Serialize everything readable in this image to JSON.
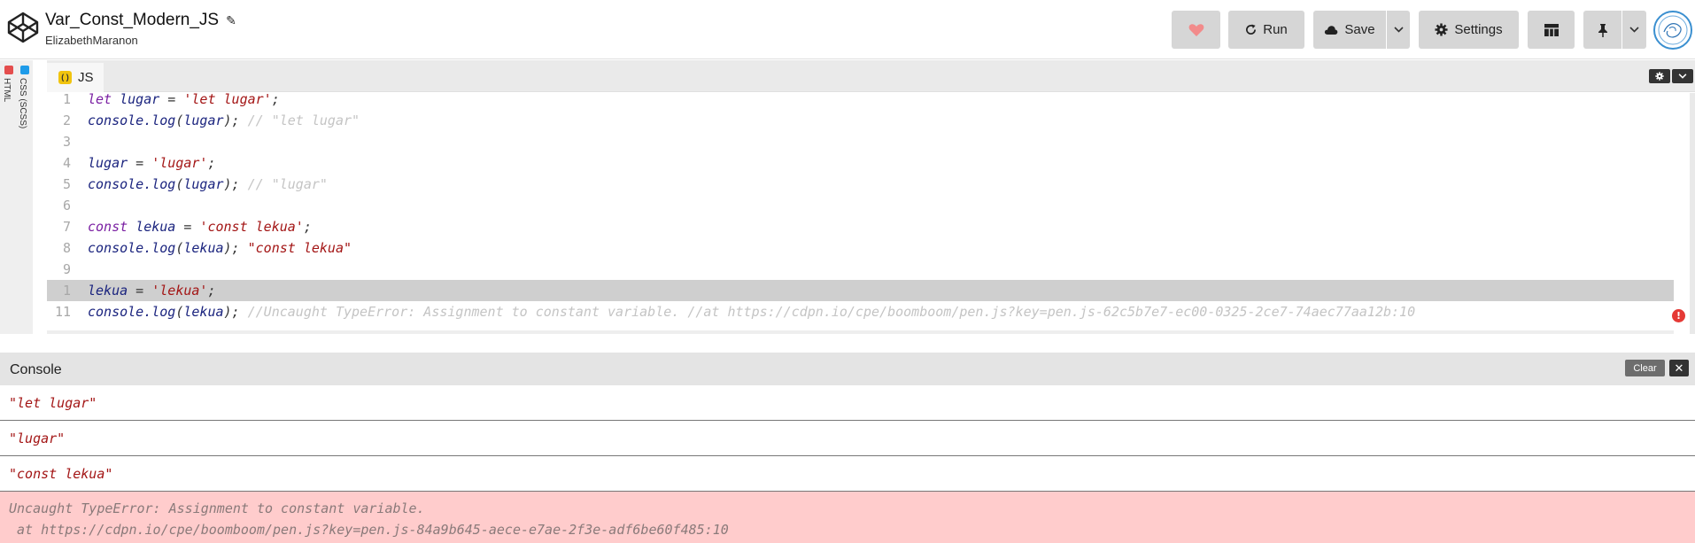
{
  "header": {
    "title": "Var_Const_Modern_JS",
    "user": "ElizabethMaranon",
    "run_label": "Run",
    "save_label": "Save",
    "settings_label": "Settings"
  },
  "side_tabs": {
    "html": "HTML",
    "css": "CSS (SCSS)"
  },
  "editor": {
    "tab_label": "JS",
    "tab_badge": "( )",
    "active_line": 10,
    "lines": [
      {
        "n": "1",
        "parts": [
          [
            "kw",
            "let "
          ],
          [
            "var",
            "lugar"
          ],
          [
            "pn",
            " = "
          ],
          [
            "str",
            "'let lugar'"
          ],
          [
            "pn",
            ";"
          ]
        ]
      },
      {
        "n": "2",
        "parts": [
          [
            "var",
            "console.log"
          ],
          [
            "pn",
            "("
          ],
          [
            "var",
            "lugar"
          ],
          [
            "pn",
            "); "
          ],
          [
            "cm",
            "// \"let lugar\""
          ]
        ]
      },
      {
        "n": "3",
        "parts": []
      },
      {
        "n": "4",
        "parts": [
          [
            "var",
            "lugar"
          ],
          [
            "pn",
            " = "
          ],
          [
            "str",
            "'lugar'"
          ],
          [
            "pn",
            ";"
          ]
        ]
      },
      {
        "n": "5",
        "parts": [
          [
            "var",
            "console.log"
          ],
          [
            "pn",
            "("
          ],
          [
            "var",
            "lugar"
          ],
          [
            "pn",
            "); "
          ],
          [
            "cm",
            "// \"lugar\""
          ]
        ]
      },
      {
        "n": "6",
        "parts": []
      },
      {
        "n": "7",
        "parts": [
          [
            "kw",
            "const "
          ],
          [
            "var",
            "lekua"
          ],
          [
            "pn",
            " = "
          ],
          [
            "str",
            "'const lekua'"
          ],
          [
            "pn",
            ";"
          ]
        ]
      },
      {
        "n": "8",
        "parts": [
          [
            "var",
            "console.log"
          ],
          [
            "pn",
            "("
          ],
          [
            "var",
            "lekua"
          ],
          [
            "pn",
            "); "
          ],
          [
            "str",
            "\"const lekua\""
          ]
        ]
      },
      {
        "n": "9",
        "parts": []
      },
      {
        "n": "1",
        "parts": [
          [
            "var",
            "lekua"
          ],
          [
            "pn",
            " = "
          ],
          [
            "str",
            "'lekua'"
          ],
          [
            "pn",
            ";"
          ]
        ]
      },
      {
        "n": "11",
        "parts": [
          [
            "var",
            "console.log"
          ],
          [
            "pn",
            "("
          ],
          [
            "var",
            "lekua"
          ],
          [
            "pn",
            "); "
          ],
          [
            "cm",
            "//Uncaught TypeError: Assignment to constant variable. //at https://cdpn.io/cpe/boomboom/pen.js?key=pen.js-62c5b7e7-ec00-0325-2ce7-74aec77aa12b:10"
          ]
        ]
      }
    ]
  },
  "console": {
    "title": "Console",
    "clear_label": "Clear",
    "close_label": "✕",
    "logs": [
      "\"let lugar\"",
      "\"lugar\"",
      "\"const lekua\""
    ],
    "error_line1": "Uncaught TypeError: Assignment to constant variable.",
    "error_line2": " at https://cdpn.io/cpe/boomboom/pen.js?key=pen.js-84a9b645-aece-e7ae-2f3e-adf6be60f485:10"
  },
  "colors": {
    "accent_heart": "#f28b8b",
    "error_bg": "#ffcccc",
    "string": "#a31515",
    "keyword": "#7a1fa2",
    "variable": "#1a237e",
    "comment": "#c4c4c4"
  },
  "icons": {
    "logo": "codepen-logo-icon",
    "heart": "heart-icon",
    "run": "refresh-icon",
    "save": "cloud-icon",
    "settings": "gear-icon",
    "layout": "layout-grid-icon",
    "pin": "pin-icon",
    "caret": "chevron-down-icon",
    "error": "error-icon"
  }
}
